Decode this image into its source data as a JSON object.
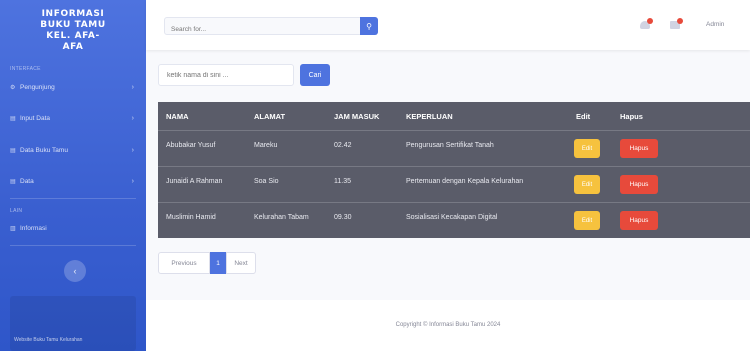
{
  "brand": {
    "line1": "INFORMASI",
    "line2": "BUKU TAMU",
    "line3": "KEL. AFA-",
    "line4": "AFA"
  },
  "sidebar": {
    "section1": "INTERFACE",
    "items": [
      {
        "label": "Pengunjung"
      },
      {
        "label": "Input Data"
      },
      {
        "label": "Data Buku Tamu"
      },
      {
        "label": "Data"
      }
    ],
    "section2": "LAIN",
    "info": "Informasi",
    "promo": "Website Buku Tamu Kelurahan"
  },
  "topbar": {
    "search_placeholder": "Search for...",
    "user_name": "Admin"
  },
  "local_search": {
    "placeholder": "ketik nama di sini ...",
    "button": "Cari"
  },
  "table": {
    "headers": {
      "nama": "NAMA",
      "alamat": "ALAMAT",
      "jam": "JAM MASUK",
      "keperluan": "KEPERLUAN",
      "edit": "Edit",
      "hapus": "Hapus"
    },
    "rows": [
      {
        "nama": "Abubakar Yusuf",
        "alamat": "Mareku",
        "jam": "02.42",
        "keperluan": "Pengurusan Sertifikat Tanah",
        "edit": "Edit",
        "hapus": "Hapus"
      },
      {
        "nama": "Junaidi A Rahman",
        "alamat": "Soa Sio",
        "jam": "11.35",
        "keperluan": "Pertemuan dengan Kepala Kelurahan",
        "edit": "Edit",
        "hapus": "Hapus"
      },
      {
        "nama": "Muslimin Hamid",
        "alamat": "Kelurahan Tabam",
        "jam": "09.30",
        "keperluan": "Sosialisasi Kecakapan Digital",
        "edit": "Edit",
        "hapus": "Hapus"
      }
    ]
  },
  "pager": {
    "prev": "Previous",
    "current": "1",
    "next": "Next"
  },
  "footer": {
    "text": "Copyright © Informasi Buku Tamu 2024"
  },
  "colors": {
    "primary": "#4e73df",
    "warning": "#f6c23e",
    "danger": "#e74a3b",
    "table_bg": "#5a5c69"
  }
}
